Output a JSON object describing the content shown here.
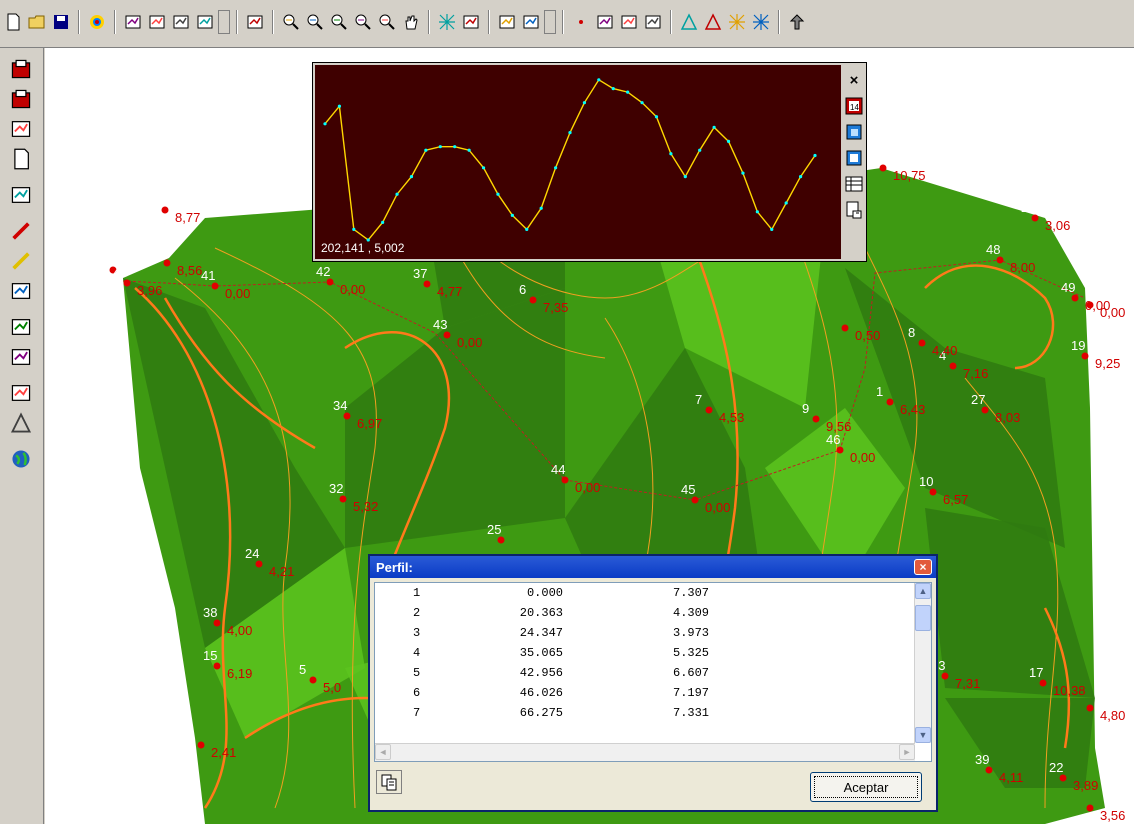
{
  "toolbar": {
    "icons": [
      "new-file-icon",
      "open-folder-icon",
      "save-icon",
      "color-palette-icon",
      "copy-layer-icon",
      "paste-layer-icon",
      "layer-properties-icon",
      "calendar-14-icon",
      "view-icon",
      "zoom-window-icon",
      "zoom-in-icon",
      "zoom-out-icon",
      "zoom-extents-icon",
      "zoom-previous-icon",
      "pan-hand-icon",
      "triangulation-icon",
      "contour-icon",
      "terrain-icon",
      "layers-icon",
      "point-icon",
      "polyline-icon",
      "break-line-icon",
      "measure-icon",
      "triangle-icon",
      "delete-triangle-icon",
      "mesh-icon",
      "mesh-alt-icon",
      "up-arrow-icon"
    ]
  },
  "lefttoolbar": {
    "icons": [
      "stack-icon",
      "edit-stack-icon",
      "list-icon",
      "document-icon",
      "contour-up-icon",
      "pencil-red-icon",
      "pencil-yellow-icon",
      "chart-icon",
      "undo-icon",
      "redo-icon",
      "valley-icon",
      "triangle-icon",
      "globe-icon"
    ]
  },
  "map": {
    "colors": {
      "dark": "#2f7a10",
      "mid": "#3e9a12",
      "light": "#5cc41e",
      "contour": "#f0a020",
      "major_contour": "#ff7a1a"
    },
    "points": [
      {
        "id": "30",
        "value": "8,77"
      },
      {
        "id": "36",
        "value": "8,56"
      },
      {
        "id": "33",
        "value": ""
      },
      {
        "id": "40",
        "value": "3,96"
      },
      {
        "id": "41",
        "value": "0,00"
      },
      {
        "id": "42",
        "value": "0,00"
      },
      {
        "id": "37",
        "value": "4,77"
      },
      {
        "id": "6",
        "value": "7,35"
      },
      {
        "id": "43",
        "value": "0,00"
      },
      {
        "id": "34",
        "value": "6,97"
      },
      {
        "id": "32",
        "value": "5,32"
      },
      {
        "id": "24",
        "value": "4,21"
      },
      {
        "id": "38",
        "value": "4,00"
      },
      {
        "id": "15",
        "value": "6,19"
      },
      {
        "id": "5",
        "value": "5,0"
      },
      {
        "id": "3",
        "value": "2,41"
      },
      {
        "id": "44",
        "value": "0,00"
      },
      {
        "id": "45",
        "value": "0,00"
      },
      {
        "id": "25",
        "value": ""
      },
      {
        "id": "7",
        "value": "4,53"
      },
      {
        "id": "9",
        "value": "9,56"
      },
      {
        "id": "46",
        "value": "0,00"
      },
      {
        "id": "1",
        "value": "6,43"
      },
      {
        "id": "10",
        "value": "6,57"
      },
      {
        "id": "27",
        "value": "8,03"
      },
      {
        "id": "4",
        "value": "7,16"
      },
      {
        "id": "8",
        "value": "4,40"
      },
      {
        "id": "19",
        "value": "9,25"
      },
      {
        "id": "48",
        "value": "8,00"
      },
      {
        "id": "26",
        "value": "3,06"
      },
      {
        "id": "49",
        "value": "0,00"
      },
      {
        "id": "2",
        "value": "10,75"
      },
      {
        "id": "13",
        "value": "7,31"
      },
      {
        "id": "17",
        "value": "10,38"
      },
      {
        "id": "39",
        "value": "4,11"
      },
      {
        "id": "22",
        "value": "3,89"
      },
      {
        "id": "",
        "value": "0,00"
      },
      {
        "id": "",
        "value": "4,80"
      },
      {
        "id": "",
        "value": "3,56"
      },
      {
        "id": "",
        "value": "0,50"
      }
    ]
  },
  "profile_window": {
    "coords": "202,141 , 5,002",
    "buttons": [
      "close-icon",
      "calendar-14-icon",
      "window-icon",
      "window-alt-icon",
      "table-icon",
      "export-icon"
    ],
    "close_label": "×",
    "line_color": "#ffd700",
    "point_color": "#00ffff",
    "background": "#3f0000",
    "profile_y": [
      0.3,
      0.2,
      0.9,
      0.96,
      0.86,
      0.7,
      0.6,
      0.45,
      0.43,
      0.43,
      0.45,
      0.55,
      0.7,
      0.82,
      0.9,
      0.78,
      0.55,
      0.35,
      0.18,
      0.05,
      0.1,
      0.12,
      0.18,
      0.26,
      0.47,
      0.6,
      0.45,
      0.32,
      0.4,
      0.58,
      0.8,
      0.9,
      0.75,
      0.6,
      0.48
    ]
  },
  "perfil": {
    "title": "Perfil:",
    "close_label": "×",
    "rows": [
      [
        "1",
        "0.000",
        "7.307"
      ],
      [
        "2",
        "20.363",
        "4.309"
      ],
      [
        "3",
        "24.347",
        "3.973"
      ],
      [
        "4",
        "35.065",
        "5.325"
      ],
      [
        "5",
        "42.956",
        "6.607"
      ],
      [
        "6",
        "46.026",
        "7.197"
      ],
      [
        "7",
        "66.275",
        "7.331"
      ]
    ],
    "scroll_up": "▲",
    "scroll_down": "▼",
    "scroll_left": "◄",
    "scroll_right": "►",
    "accept_label": "Aceptar"
  }
}
